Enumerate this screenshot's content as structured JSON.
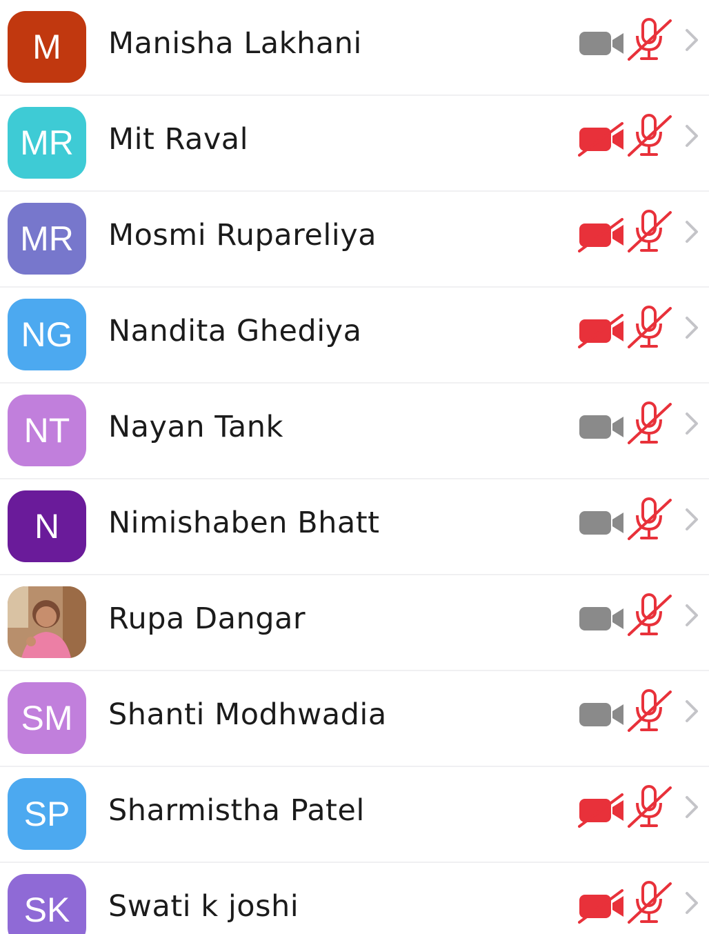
{
  "participants": [
    {
      "initials": "M",
      "name": "Manisha Lakhani",
      "avatar_color": "#c1380f",
      "video_muted": false,
      "audio_muted": true
    },
    {
      "initials": "MR",
      "name": "Mit Raval",
      "avatar_color": "#3ecbd5",
      "video_muted": true,
      "audio_muted": true
    },
    {
      "initials": "MR",
      "name": "Mosmi Rupareliya",
      "avatar_color": "#7777cc",
      "video_muted": true,
      "audio_muted": true
    },
    {
      "initials": "NG",
      "name": "Nandita Ghediya",
      "avatar_color": "#4ca9f0",
      "video_muted": true,
      "audio_muted": true
    },
    {
      "initials": "NT",
      "name": "Nayan Tank",
      "avatar_color": "#c17fdc",
      "video_muted": false,
      "audio_muted": true
    },
    {
      "initials": "N",
      "name": "Nimishaben Bhatt",
      "avatar_color": "#6a1b9a",
      "video_muted": false,
      "audio_muted": true
    },
    {
      "initials": "",
      "name": "Rupa Dangar",
      "avatar_color": "#c9a98a",
      "avatar_photo": true,
      "video_muted": false,
      "audio_muted": true
    },
    {
      "initials": "SM",
      "name": "Shanti Modhwadia",
      "avatar_color": "#c17fdc",
      "video_muted": false,
      "audio_muted": true
    },
    {
      "initials": "SP",
      "name": "Sharmistha Patel",
      "avatar_color": "#4ca9f0",
      "video_muted": true,
      "audio_muted": true
    },
    {
      "initials": "SK",
      "name": "Swati k joshi",
      "avatar_color": "#8f6ad6",
      "video_muted": true,
      "audio_muted": true
    }
  ],
  "colors": {
    "muted_red": "#e8313a",
    "video_on_gray": "#8a8a8a",
    "chevron_gray": "#c4c4c8"
  },
  "icons": {
    "video": "video-camera-icon",
    "mic": "microphone-icon",
    "chevron": "chevron-right-icon"
  }
}
